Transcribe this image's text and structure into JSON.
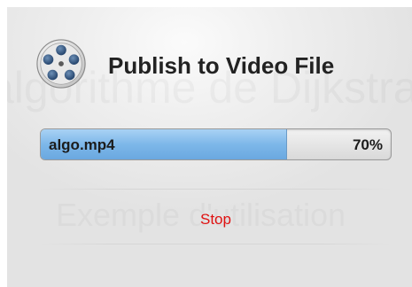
{
  "dialog": {
    "title": "Publish to Video File",
    "icon": "film-reel-icon",
    "background_watermark": [
      "algorithme de Dijkstra",
      "Exemple d'utilisation"
    ]
  },
  "progress": {
    "filename": "algo.mp4",
    "percent_label": "70%",
    "fraction": 0.7
  },
  "actions": {
    "stop_label": "Stop",
    "stop_color": "#e01010"
  },
  "colors": {
    "progress_fill": "#7db7e9"
  }
}
